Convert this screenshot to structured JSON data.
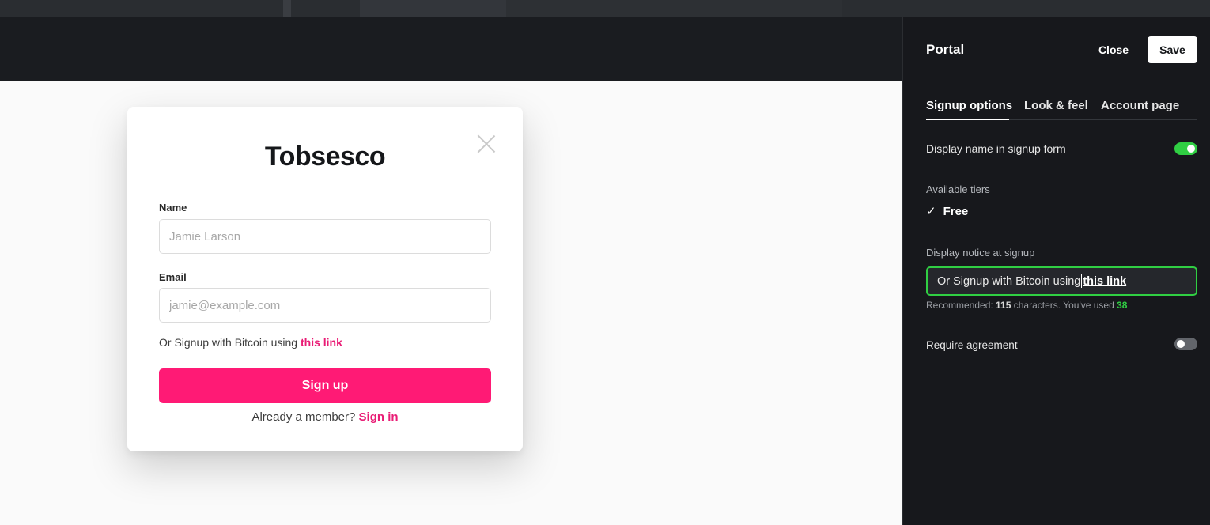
{
  "preview": {
    "site_title": "Tobsesco",
    "name_label": "Name",
    "name_placeholder": "Jamie Larson",
    "email_label": "Email",
    "email_placeholder": "jamie@example.com",
    "notice_text": "Or Signup with Bitcoin using ",
    "notice_link": "this link",
    "signup_button": "Sign up",
    "member_text": "Already a member? ",
    "signin_link": "Sign in"
  },
  "panel": {
    "title": "Portal",
    "close_label": "Close",
    "save_label": "Save",
    "tabs": [
      {
        "label": "Signup options",
        "active": true
      },
      {
        "label": "Look & feel",
        "active": false
      },
      {
        "label": "Account page",
        "active": false
      }
    ],
    "display_name_label": "Display name in signup form",
    "display_name_on": true,
    "tiers_label": "Available tiers",
    "tier_check": "✓",
    "tier_name": "Free",
    "notice_label": "Display notice at signup",
    "notice_value_plain": "Or Signup with Bitcoin using ",
    "notice_value_link": "this link",
    "hint_prefix": "Recommended: ",
    "hint_recommended": "115",
    "hint_middle": " characters. You've used ",
    "hint_used": "38",
    "require_agreement_label": "Require agreement",
    "require_agreement_on": false
  },
  "colors": {
    "accent": "#ff1a75",
    "toggle_on": "#30cf43",
    "panel_bg": "#17181c"
  }
}
